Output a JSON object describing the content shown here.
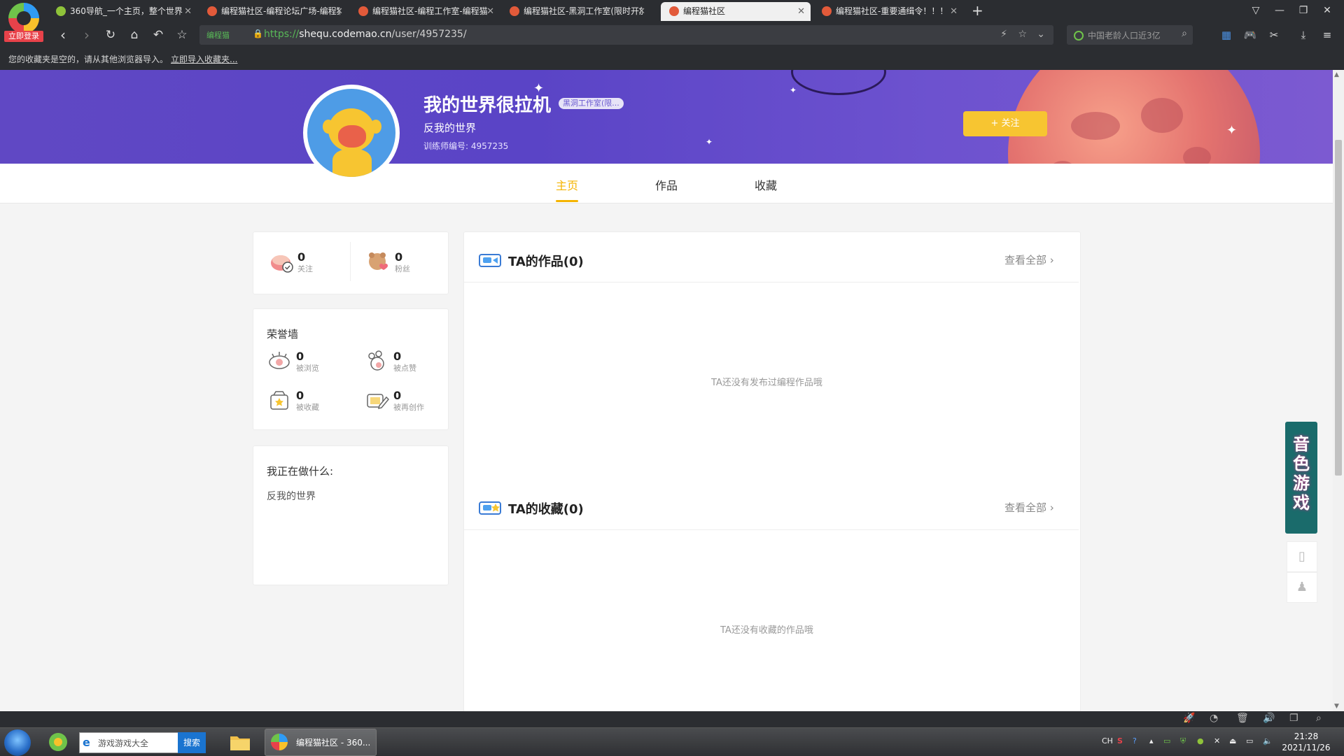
{
  "browser": {
    "login_badge": "立即登录",
    "tabs": [
      {
        "title": "360导航_一个主页，整个世界"
      },
      {
        "title": "编程猫社区-编程论坛广场-编程猫"
      },
      {
        "title": "编程猫社区-编程工作室-编程猫"
      },
      {
        "title": "编程猫社区-黑洞工作室(限时开放)"
      },
      {
        "title": "编程猫社区"
      },
      {
        "title": "编程猫社区-重要通缉令！！！"
      }
    ],
    "active_tab_index": 4,
    "new_tab": "+",
    "address": {
      "cert_label": "编程猫",
      "url_scheme": "https://",
      "url_host": "shequ.codemao.cn",
      "url_path": "/user/4957235/"
    },
    "search_placeholder": "中国老龄人口近3亿",
    "favbar_message": "您的收藏夹是空的，请从其他浏览器导入。",
    "favbar_link": "立即导入收藏夹..."
  },
  "profile": {
    "name": "我的世界很拉机",
    "studio_badge": "黑洞工作室(限...",
    "motto": "反我的世界",
    "trainer_id": "训练师编号: 4957235",
    "follow_button": "+ 关注"
  },
  "page_tabs": [
    "主页",
    "作品",
    "收藏"
  ],
  "active_page_tab": 0,
  "follow_stats": [
    {
      "value": "0",
      "label": "关注"
    },
    {
      "value": "0",
      "label": "粉丝"
    }
  ],
  "honor_wall": {
    "title": "荣誉墙",
    "items": [
      {
        "value": "0",
        "label": "被浏览"
      },
      {
        "value": "0",
        "label": "被点赞"
      },
      {
        "value": "0",
        "label": "被收藏"
      },
      {
        "value": "0",
        "label": "被再创作"
      }
    ]
  },
  "doing": {
    "title": "我正在做什么:",
    "text": "反我的世界"
  },
  "works_section": {
    "title": "TA的作品(0)",
    "more": "查看全部",
    "empty": "TA还没有发布过编程作品哦"
  },
  "collect_section": {
    "title": "TA的收藏(0)",
    "more": "查看全部",
    "empty": "TA还没有收藏的作品哦"
  },
  "side_ad": "音色游戏",
  "taskbar": {
    "search_value": "游戏游戏大全",
    "search_button": "搜索",
    "task_title": "编程猫社区 - 360...",
    "tray_lang": "CH",
    "time": "21:28",
    "date": "2021/11/26"
  },
  "colors": {
    "accent": "#f5b400",
    "banner": "#6048c4",
    "secure": "#58b957"
  }
}
